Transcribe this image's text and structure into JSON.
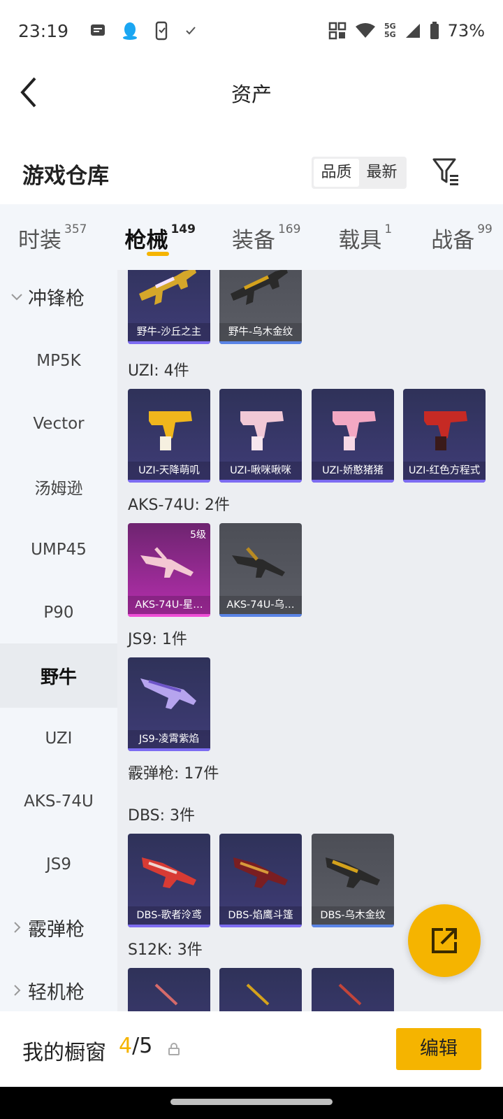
{
  "status": {
    "time": "23:19",
    "network": "5G",
    "battery": "73%"
  },
  "header": {
    "title": "资产"
  },
  "warehouse": {
    "title": "游戏仓库",
    "sort_options": [
      "品质",
      "最新"
    ],
    "sort_active": "品质"
  },
  "tabs": [
    {
      "label": "时装",
      "count": "357"
    },
    {
      "label": "枪械",
      "count": "149"
    },
    {
      "label": "装备",
      "count": "169"
    },
    {
      "label": "载具",
      "count": "1"
    },
    {
      "label": "战备",
      "count": "99"
    }
  ],
  "active_tab": "枪械",
  "sidebar": {
    "group_smg": "冲锋枪",
    "items": [
      "MP5K",
      "Vector",
      "汤姆逊",
      "UMP45",
      "P90",
      "野牛",
      "UZI",
      "AKS-74U",
      "JS9"
    ],
    "active": "野牛",
    "group_shotgun": "霰弹枪",
    "group_lmg": "轻机枪"
  },
  "sections": [
    {
      "label": "",
      "cards": [
        {
          "name": "野牛-沙丘之主",
          "rarity": "purple"
        },
        {
          "name": "野牛-乌木金纹",
          "rarity": "gray"
        }
      ]
    },
    {
      "label": "UZI: 4件",
      "cards": [
        {
          "name": "UZI-天降萌叽",
          "rarity": "purple"
        },
        {
          "name": "UZI-啾咪啾咪",
          "rarity": "purple"
        },
        {
          "name": "UZI-娇憨猪猪",
          "rarity": "purple"
        },
        {
          "name": "UZI-红色方程式",
          "rarity": "purple"
        }
      ]
    },
    {
      "label": "AKS-74U: 2件",
      "cards": [
        {
          "name": "AKS-74U-星…",
          "rarity": "pink",
          "level": "5级"
        },
        {
          "name": "AKS-74U-乌…",
          "rarity": "gray"
        }
      ]
    },
    {
      "label": "JS9: 1件",
      "cards": [
        {
          "name": "JS9-凌霄紫焰",
          "rarity": "purple"
        }
      ]
    },
    {
      "label": "霰弹枪: 17件",
      "cards": []
    },
    {
      "label": "DBS: 3件",
      "cards": [
        {
          "name": "DBS-歌者泠鸢",
          "rarity": "purple"
        },
        {
          "name": "DBS-焰鹰斗篷",
          "rarity": "purple"
        },
        {
          "name": "DBS-乌木金纹",
          "rarity": "gray"
        }
      ]
    },
    {
      "label": "S12K: 3件",
      "cards": [
        {
          "name": "",
          "rarity": "purple"
        },
        {
          "name": "",
          "rarity": "purple"
        },
        {
          "name": "",
          "rarity": "purple"
        }
      ]
    }
  ],
  "showcase": {
    "label": "我的橱窗",
    "current": "4",
    "separator": "/",
    "total": "5",
    "edit_label": "编辑"
  },
  "colors": {
    "accent": "#f5b400",
    "purple_rarity": "#7d6cf2",
    "gray_rarity": "#5a84e6",
    "pink_rarity": "#ee4fd6"
  },
  "icons": [
    "back-arrow-icon",
    "filter-icon",
    "chevron-down-icon",
    "chevron-right-icon",
    "share-external-icon",
    "lock-icon"
  ]
}
